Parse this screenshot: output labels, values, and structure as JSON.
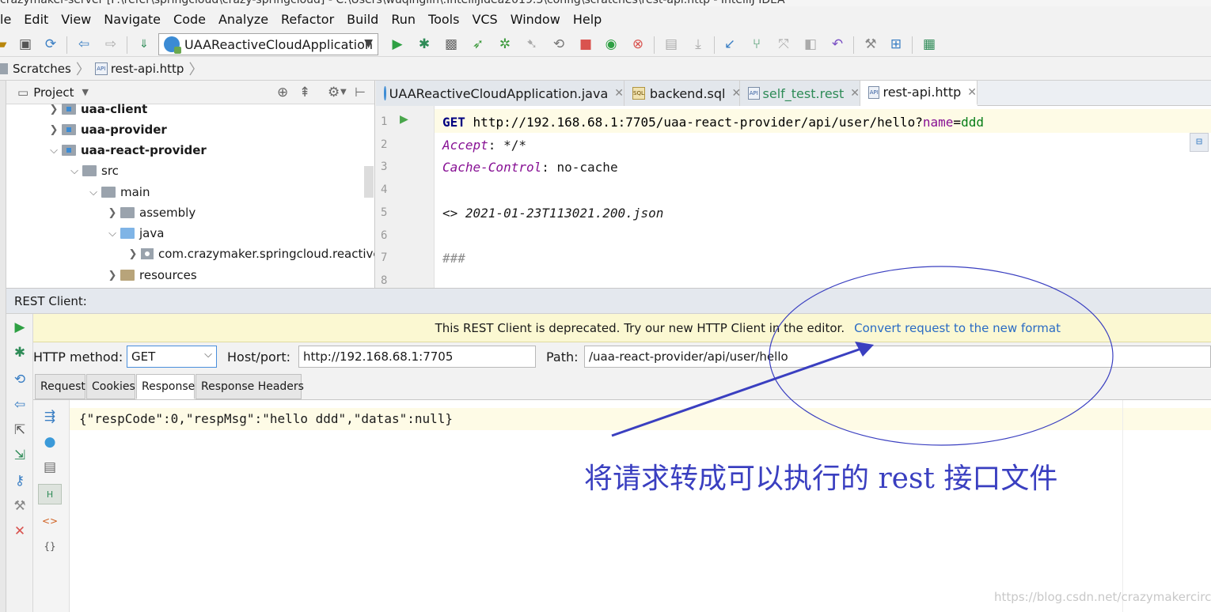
{
  "window": {
    "title_fragment": "crazymaker-server [F:\\refer\\springcloud\\crazy-springcloud] - C:\\Users\\wuqinglin\\.IntelliJIdea2019.3\\config\\scratches\\rest-api.http - IntelliJ IDEA"
  },
  "menu": [
    "le",
    "Edit",
    "View",
    "Navigate",
    "Code",
    "Analyze",
    "Refactor",
    "Build",
    "Run",
    "Tools",
    "VCS",
    "Window",
    "Help"
  ],
  "toolbar": {
    "run_config": "UAAReactiveCloudApplication"
  },
  "breadcrumb": {
    "items": [
      "Scratches",
      "rest-api.http"
    ],
    "api_icon": "API"
  },
  "project": {
    "title": "Project",
    "tree": [
      {
        "label": "uaa-client",
        "bold": true
      },
      {
        "label": "uaa-provider",
        "bold": true
      },
      {
        "label": "uaa-react-provider",
        "bold": true
      },
      {
        "label": "src"
      },
      {
        "label": "main"
      },
      {
        "label": "assembly"
      },
      {
        "label": "java"
      },
      {
        "label": "com.crazymaker.springcloud.reactive"
      },
      {
        "label": "resources"
      }
    ]
  },
  "editor": {
    "tabs": [
      {
        "label": "UAAReactiveCloudApplication.java"
      },
      {
        "label": "backend.sql",
        "icon_text": "SQL"
      },
      {
        "label": "self_test.rest",
        "icon_text": "API"
      },
      {
        "label": "rest-api.http",
        "icon_text": "API"
      }
    ],
    "line_numbers": [
      "1",
      "2",
      "3",
      "4",
      "5",
      "6",
      "7",
      "8"
    ],
    "line1": {
      "method": "GET",
      "url": "http://192.168.68.1:7705/uaa-react-provider/api/user/hello?",
      "param_name": "name",
      "eq": "=",
      "param_value": "ddd"
    },
    "line2": {
      "header": "Accept",
      "colon": ":",
      "value": " */*"
    },
    "line3": {
      "header": "Cache-Control",
      "colon": ":",
      "value": " no-cache"
    },
    "line5": {
      "arrow": "<>",
      "file": " 2021-01-23T113021.200.json"
    },
    "line7": "###"
  },
  "rest_client": {
    "title": "REST Client:",
    "deprecated_msg": "This REST Client is deprecated. Try our new HTTP Client in the editor.",
    "convert_link": "Convert request to the new format",
    "method_label": "HTTP method:",
    "method_value": "GET",
    "host_label": "Host/port:",
    "host_value": "http://192.168.68.1:7705",
    "path_label": "Path:",
    "path_value": "/uaa-react-provider/api/user/hello",
    "tabs": [
      "Request",
      "Cookies",
      "Response",
      "Response Headers"
    ],
    "response": "{\"respCode\":0,\"respMsg\":\"hello ddd\",\"datas\":null}"
  },
  "annotation": {
    "text": "将请求转成可以执行的 rest 接口文件",
    "color": "#3a3fc0"
  },
  "watermark": "https://blog.csdn.net/crazymakercircle"
}
